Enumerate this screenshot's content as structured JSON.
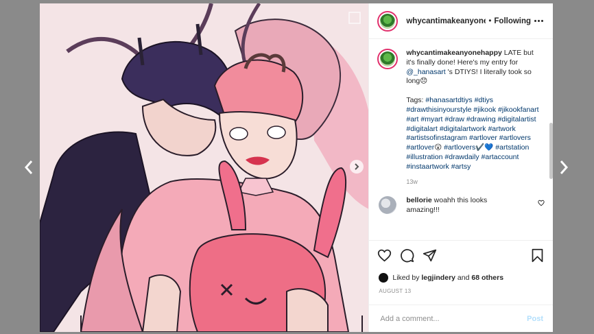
{
  "header": {
    "username": "whycantimakeanyonehappy",
    "separator": "•",
    "follow_status": "Following"
  },
  "caption": {
    "username": "whycantimakeanyonehappy",
    "text_before_mention": " LATE but it's finally done! Here's my entry for ",
    "mention": "@_hanasart",
    "text_after_mention": " 's DTIYS! I literally took so long",
    "emoji": "😞",
    "tags_label": "Tags: ",
    "hashtags": [
      "#hanasartdtiys",
      "#dtiys",
      "#drawthisinyourstyle",
      "#jikook",
      "#jikookfanart",
      "#art",
      "#myart",
      "#draw",
      "#drawing",
      "#digitalartist",
      "#digitalart",
      "#digitalartwork",
      "#artwork",
      "#artistsofinstagram",
      "#artlover",
      "#artlovers",
      "#artlover",
      "#artlovers",
      "#artstation",
      "#illustration",
      "#drawdaily",
      "#artaccount",
      "#instaartwork",
      "#artsy"
    ],
    "inline_emojis": [
      "😲",
      "✔️",
      "💙"
    ],
    "time_ago": "13w"
  },
  "comment": {
    "username": "bellorie",
    "text": "woahh this looks amazing!!!"
  },
  "likes": {
    "prefix": "Liked by ",
    "user": "legjindery",
    "joiner": " and ",
    "others": "68 others"
  },
  "date": "AUGUST 13",
  "add_comment": {
    "placeholder": "Add a comment...",
    "post_label": "Post"
  },
  "icons": {
    "prev": "chevron-left-icon",
    "next": "chevron-right-icon",
    "more": "more-icon",
    "like": "heart-icon",
    "comment": "comment-icon",
    "share": "share-icon",
    "save": "bookmark-icon"
  },
  "colors": {
    "link": "#00376b",
    "story_ring": "#e1306c",
    "post_button": "#b2dffc"
  }
}
